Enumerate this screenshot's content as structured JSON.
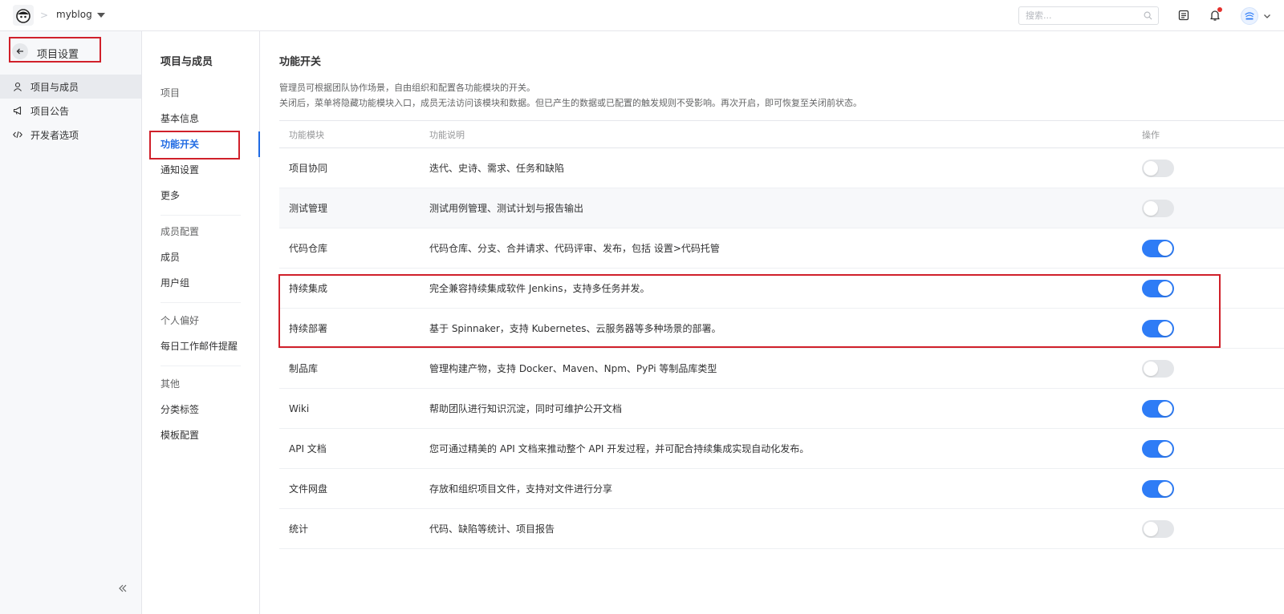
{
  "topbar": {
    "project_name": "myblog",
    "breadcrumb_sep": ">",
    "search_placeholder": "搜索..."
  },
  "sidebar": {
    "back_title": "项目设置",
    "items": [
      {
        "label": "项目与成员",
        "icon": "user-icon",
        "active": true
      },
      {
        "label": "项目公告",
        "icon": "megaphone-icon",
        "active": false
      },
      {
        "label": "开发者选项",
        "icon": "code-icon",
        "active": false
      }
    ],
    "collapse_glyph": "«"
  },
  "subnav": {
    "title": "项目与成员",
    "groups": [
      {
        "title": "项目",
        "items": [
          "基本信息",
          "功能开关",
          "通知设置",
          "更多"
        ]
      },
      {
        "title": "成员配置",
        "items": [
          "成员",
          "用户组"
        ]
      },
      {
        "title": "个人偏好",
        "items": [
          "每日工作邮件提醒"
        ]
      },
      {
        "title": "其他",
        "items": [
          "分类标签",
          "模板配置"
        ]
      }
    ],
    "active_item": "功能开关"
  },
  "main": {
    "title": "功能开关",
    "desc_line1": "管理员可根据团队协作场景，自由组织和配置各功能模块的开关。",
    "desc_line2": "关闭后，菜单将隐藏功能模块入口，成员无法访问该模块和数据。但已产生的数据或已配置的触发规则不受影响。再次开启，即可恢复至关闭前状态。",
    "columns": [
      "功能模块",
      "功能说明",
      "操作"
    ],
    "rows": [
      {
        "module": "项目协同",
        "desc": "迭代、史诗、需求、任务和缺陷",
        "enabled": false
      },
      {
        "module": "测试管理",
        "desc": "测试用例管理、测试计划与报告输出",
        "enabled": false
      },
      {
        "module": "代码仓库",
        "desc": "代码仓库、分支、合并请求、代码评审、发布，包括 设置>代码托管",
        "enabled": true
      },
      {
        "module": "持续集成",
        "desc": "完全兼容持续集成软件 Jenkins，支持多任务并发。",
        "enabled": true
      },
      {
        "module": "持续部署",
        "desc": "基于 Spinnaker，支持 Kubernetes、云服务器等多种场景的部署。",
        "enabled": true
      },
      {
        "module": "制品库",
        "desc": "管理构建产物，支持 Docker、Maven、Npm、PyPi 等制品库类型",
        "enabled": false
      },
      {
        "module": "Wiki",
        "desc": "帮助团队进行知识沉淀，同时可维护公开文档",
        "enabled": true
      },
      {
        "module": "API 文档",
        "desc": "您可通过精美的 API 文档来推动整个 API 开发过程，并可配合持续集成实现自动化发布。",
        "enabled": true
      },
      {
        "module": "文件网盘",
        "desc": "存放和组织项目文件，支持对文件进行分享",
        "enabled": true
      },
      {
        "module": "统计",
        "desc": "代码、缺陷等统计、项目报告",
        "enabled": false
      }
    ]
  },
  "colors": {
    "accent": "#1f6ae3",
    "toggle_on": "#2e7cf6",
    "toggle_off": "#e4e6e9",
    "highlight_border": "#d0202a"
  }
}
